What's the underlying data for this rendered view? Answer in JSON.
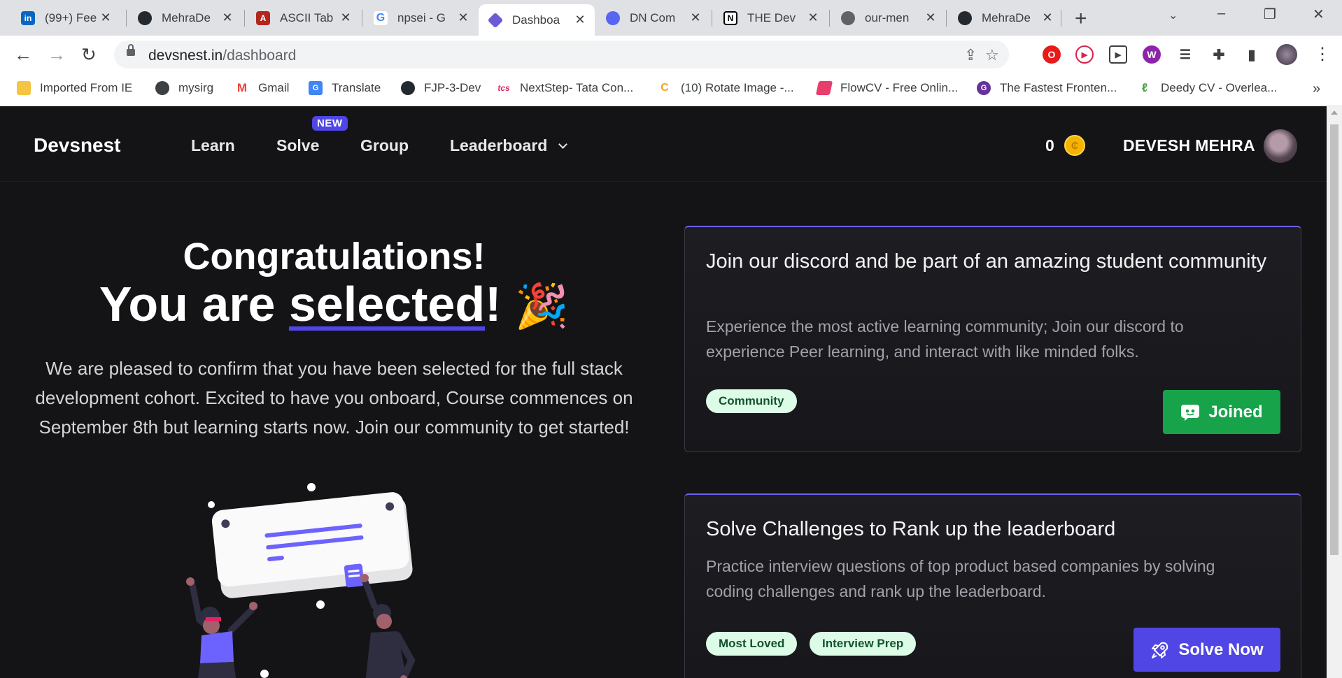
{
  "browser": {
    "tabs": [
      {
        "title": "(99+) Fee",
        "favicon": "LinkedIn",
        "fav_text": "in",
        "fav_color": "#0a66c2"
      },
      {
        "title": "MehraDe",
        "favicon": "GitHub",
        "fav_text": "",
        "fav_color": "#24292f"
      },
      {
        "title": "ASCII Tab",
        "favicon": "ASCII",
        "fav_text": "A",
        "fav_color": "#b3261e"
      },
      {
        "title": "npsei - G",
        "favicon": "Google",
        "fav_text": "G",
        "fav_color": "#4285f4"
      },
      {
        "title": "Dashboa",
        "favicon": "Devsnest",
        "fav_text": "",
        "fav_color": "#6b5bd6",
        "active": true
      },
      {
        "title": "DN Com",
        "favicon": "Discord",
        "fav_text": "",
        "fav_color": "#5865f2"
      },
      {
        "title": "THE Dev",
        "favicon": "Notion",
        "fav_text": "N",
        "fav_color": "#000000"
      },
      {
        "title": "our-men",
        "favicon": "Globe",
        "fav_text": "",
        "fav_color": "#5f6368"
      },
      {
        "title": "MehraDe",
        "favicon": "GitHub",
        "fav_text": "",
        "fav_color": "#24292f"
      }
    ],
    "address": {
      "host": "devsnest.in",
      "path": "/dashboard"
    },
    "bookmarks": [
      {
        "label": "Imported From IE",
        "icon": "folder-icon",
        "color": "#f4c542"
      },
      {
        "label": "mysirg",
        "icon": "globe-icon",
        "color": "#3c4043"
      },
      {
        "label": "Gmail",
        "icon": "gmail-icon",
        "color": "#ea4335"
      },
      {
        "label": "Translate",
        "icon": "translate-icon",
        "color": "#4285f4"
      },
      {
        "label": "FJP-3-Dev",
        "icon": "github-icon",
        "color": "#24292f"
      },
      {
        "label": "NextStep- Tata Con...",
        "icon": "tcs-icon",
        "color": "#e0245e"
      },
      {
        "label": "(10) Rotate Image -...",
        "icon": "leetcode-icon",
        "color": "#f89f1b"
      },
      {
        "label": "FlowCV - Free Onlin...",
        "icon": "flowcv-icon",
        "color": "#e83e6c"
      },
      {
        "label": "The Fastest Fronten...",
        "icon": "gatsby-icon",
        "color": "#663399"
      },
      {
        "label": "Deedy CV - Overlea...",
        "icon": "overleaf-icon",
        "color": "#47a141"
      }
    ]
  },
  "site": {
    "brand": "Devsnest",
    "nav": {
      "learn": "Learn",
      "solve": "Solve",
      "new_badge": "NEW",
      "group": "Group",
      "leaderboard": "Leaderboard"
    },
    "coins": "0",
    "username": "DEVESH MEHRA"
  },
  "hero": {
    "line1": "Congratulations!",
    "line2_pre": "You are ",
    "line2_sel": "selected",
    "line2_post": "!",
    "emoji": "🎉",
    "message": "We are pleased to confirm that you have been selected for the full stack development cohort. Excited to have you onboard, Course commences on September 8th but learning starts now. Join our community to get started!"
  },
  "cards": {
    "discord": {
      "title": "Join our discord and be part of an amazing student community",
      "desc": "Experience the most active learning community; Join our discord to experience Peer learning, and interact with like minded folks.",
      "tags": [
        "Community"
      ],
      "button": "Joined",
      "button_color": "#16a34a"
    },
    "challenges": {
      "title": "Solve Challenges to Rank up the leaderboard",
      "desc": "Practice interview questions of top product based companies by solving coding challenges and rank up the leaderboard.",
      "tags": [
        "Most Loved",
        "Interview Prep"
      ],
      "button": "Solve Now",
      "button_color": "#4f46e5"
    }
  }
}
